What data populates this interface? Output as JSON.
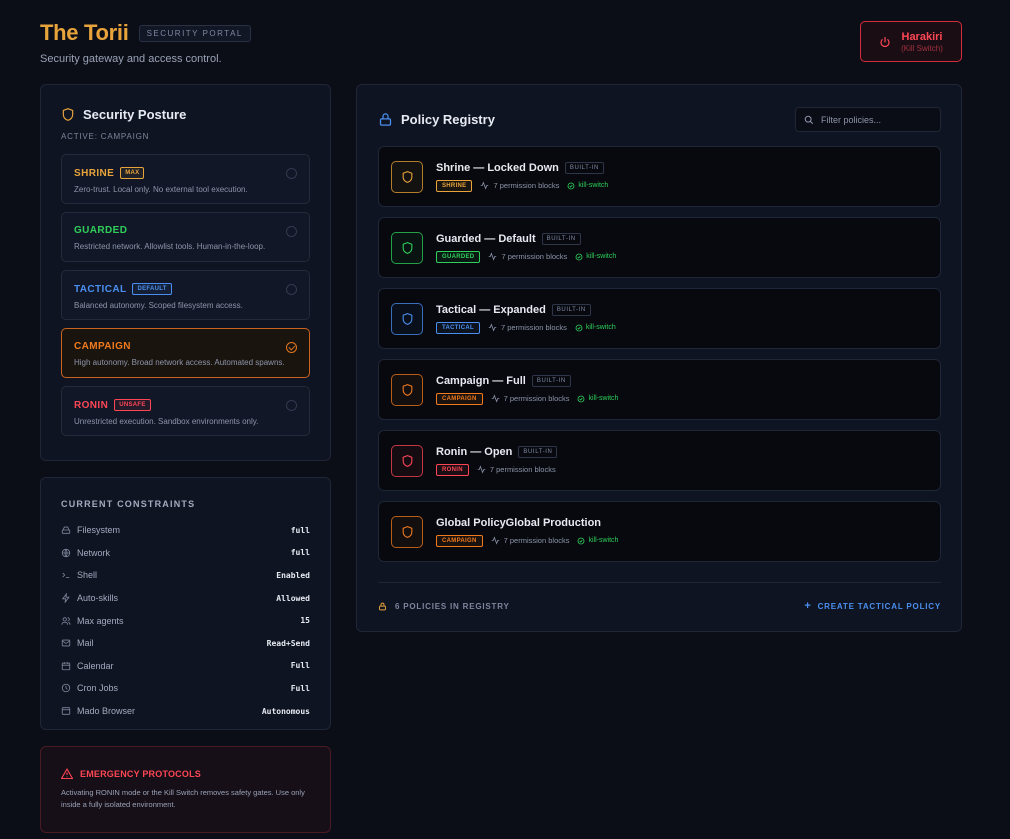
{
  "header": {
    "title": "The Torii",
    "badge": "SECURITY PORTAL",
    "subtitle": "Security gateway and access control.",
    "kill_switch": {
      "title": "Harakiri",
      "subtitle": "(Kill Switch)"
    }
  },
  "posture": {
    "title": "Security Posture",
    "active_label": "ACTIVE: CAMPAIGN",
    "modes": [
      {
        "name": "SHRINE",
        "tag": "MAX",
        "desc": "Zero-trust. Local only. No external tool execution.",
        "color": "#e8a33a",
        "selected": false
      },
      {
        "name": "GUARDED",
        "tag": "",
        "desc": "Restricted network. Allowlist tools. Human-in-the-loop.",
        "color": "#2fcf5a",
        "selected": false
      },
      {
        "name": "TACTICAL",
        "tag": "DEFAULT",
        "desc": "Balanced autonomy. Scoped filesystem access.",
        "color": "#4a8ff0",
        "selected": false
      },
      {
        "name": "CAMPAIGN",
        "tag": "",
        "desc": "High autonomy. Broad network access. Automated spawns.",
        "color": "#f07a1e",
        "selected": true
      },
      {
        "name": "RONIN",
        "tag": "UNSAFE",
        "desc": "Unrestricted execution. Sandbox environments only.",
        "color": "#ff4655",
        "selected": false
      }
    ]
  },
  "constraints": {
    "label": "CURRENT CONSTRAINTS",
    "items": [
      {
        "name": "Filesystem",
        "value": "full",
        "icon": "drive-icon"
      },
      {
        "name": "Network",
        "value": "full",
        "icon": "globe-icon"
      },
      {
        "name": "Shell",
        "value": "Enabled",
        "icon": "terminal-icon"
      },
      {
        "name": "Auto-skills",
        "value": "Allowed",
        "icon": "bolt-icon"
      },
      {
        "name": "Max agents",
        "value": "15",
        "icon": "users-icon"
      },
      {
        "name": "Mail",
        "value": "Read+Send",
        "icon": "mail-icon"
      },
      {
        "name": "Calendar",
        "value": "Full",
        "icon": "calendar-icon"
      },
      {
        "name": "Cron Jobs",
        "value": "Full",
        "icon": "clock-icon"
      },
      {
        "name": "Mado Browser",
        "value": "Autonomous",
        "icon": "browser-icon"
      }
    ]
  },
  "emergency": {
    "title": "EMERGENCY PROTOCOLS",
    "text": "Activating RONIN mode or the Kill Switch removes safety gates. Use only inside a fully isolated environment."
  },
  "registry": {
    "title": "Policy Registry",
    "search_placeholder": "Filter policies...",
    "policies": [
      {
        "title": "Shrine — Locked Down",
        "builtin": "BUILT-IN",
        "tag": "SHRINE",
        "blocks": "7 permission blocks",
        "kill_switch": "kill-switch",
        "color": "#e8a33a"
      },
      {
        "title": "Guarded — Default",
        "builtin": "BUILT-IN",
        "tag": "GUARDED",
        "blocks": "7 permission blocks",
        "kill_switch": "kill-switch",
        "color": "#2fcf5a"
      },
      {
        "title": "Tactical — Expanded",
        "builtin": "BUILT-IN",
        "tag": "TACTICAL",
        "blocks": "7 permission blocks",
        "kill_switch": "kill-switch",
        "color": "#4a8ff0"
      },
      {
        "title": "Campaign — Full",
        "builtin": "BUILT-IN",
        "tag": "CAMPAIGN",
        "blocks": "7 permission blocks",
        "kill_switch": "kill-switch",
        "color": "#f07a1e"
      },
      {
        "title": "Ronin — Open",
        "builtin": "BUILT-IN",
        "tag": "RONIN",
        "blocks": "7 permission blocks",
        "kill_switch": "",
        "color": "#ff4655"
      },
      {
        "title": "Global PolicyGlobal Production",
        "builtin": "",
        "tag": "CAMPAIGN",
        "blocks": "7 permission blocks",
        "kill_switch": "kill-switch",
        "color": "#f07a1e"
      }
    ],
    "count_label": "6 POLICIES IN REGISTRY",
    "create_label": "CREATE TACTICAL POLICY"
  }
}
